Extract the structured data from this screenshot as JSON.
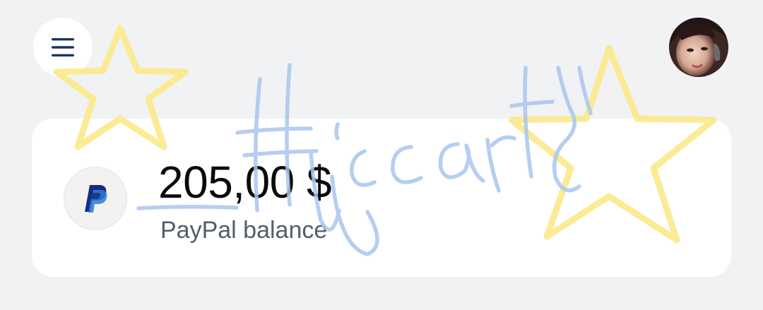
{
  "header": {
    "menu_icon": "hamburger-menu-icon",
    "avatar_icon": "user-avatar"
  },
  "balance_card": {
    "amount": "205,00 $",
    "label": "PayPal balance",
    "logo_icon": "paypal-logo-icon"
  },
  "colors": {
    "background": "#f1f2f4",
    "card": "#ffffff",
    "menu_icon": "#1a3665",
    "amount_text": "#0b0b0b",
    "label_text": "#545d68",
    "paypal_dark_blue": "#1b2a85",
    "paypal_light_blue": "#2a7fd1",
    "overlay_star_yellow": "#fbe98a",
    "overlay_scribble_blue": "#a9c6ef"
  }
}
